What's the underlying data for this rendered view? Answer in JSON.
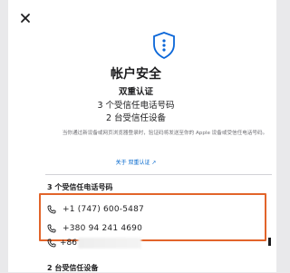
{
  "dialog": {
    "title": "帐户安全",
    "subtitle": "双重认证",
    "trusted_phone_summary": "3 个受信任电话号码",
    "trusted_device_summary": "2 台受信任设备",
    "description": "当你通过新设备或网页浏览器登录时，验证码将发送至你的 Apple 设备或受信任电话号码。",
    "learn_more_link": "关于 双重认证 ↗"
  },
  "phones": {
    "header": "3 个受信任电话号码",
    "items": [
      {
        "number": "+1 (747) 600-5487"
      },
      {
        "number": "+380 94 241 4690"
      },
      {
        "number": "+86"
      }
    ]
  },
  "devices": {
    "header": "2 台受信任设备"
  },
  "colors": {
    "highlight": "#e2642a",
    "link": "#0066cc",
    "text": "#1d1d1f"
  },
  "icons": {
    "close": "close-icon",
    "shield": "shield-icon",
    "phone": "phone-icon"
  }
}
